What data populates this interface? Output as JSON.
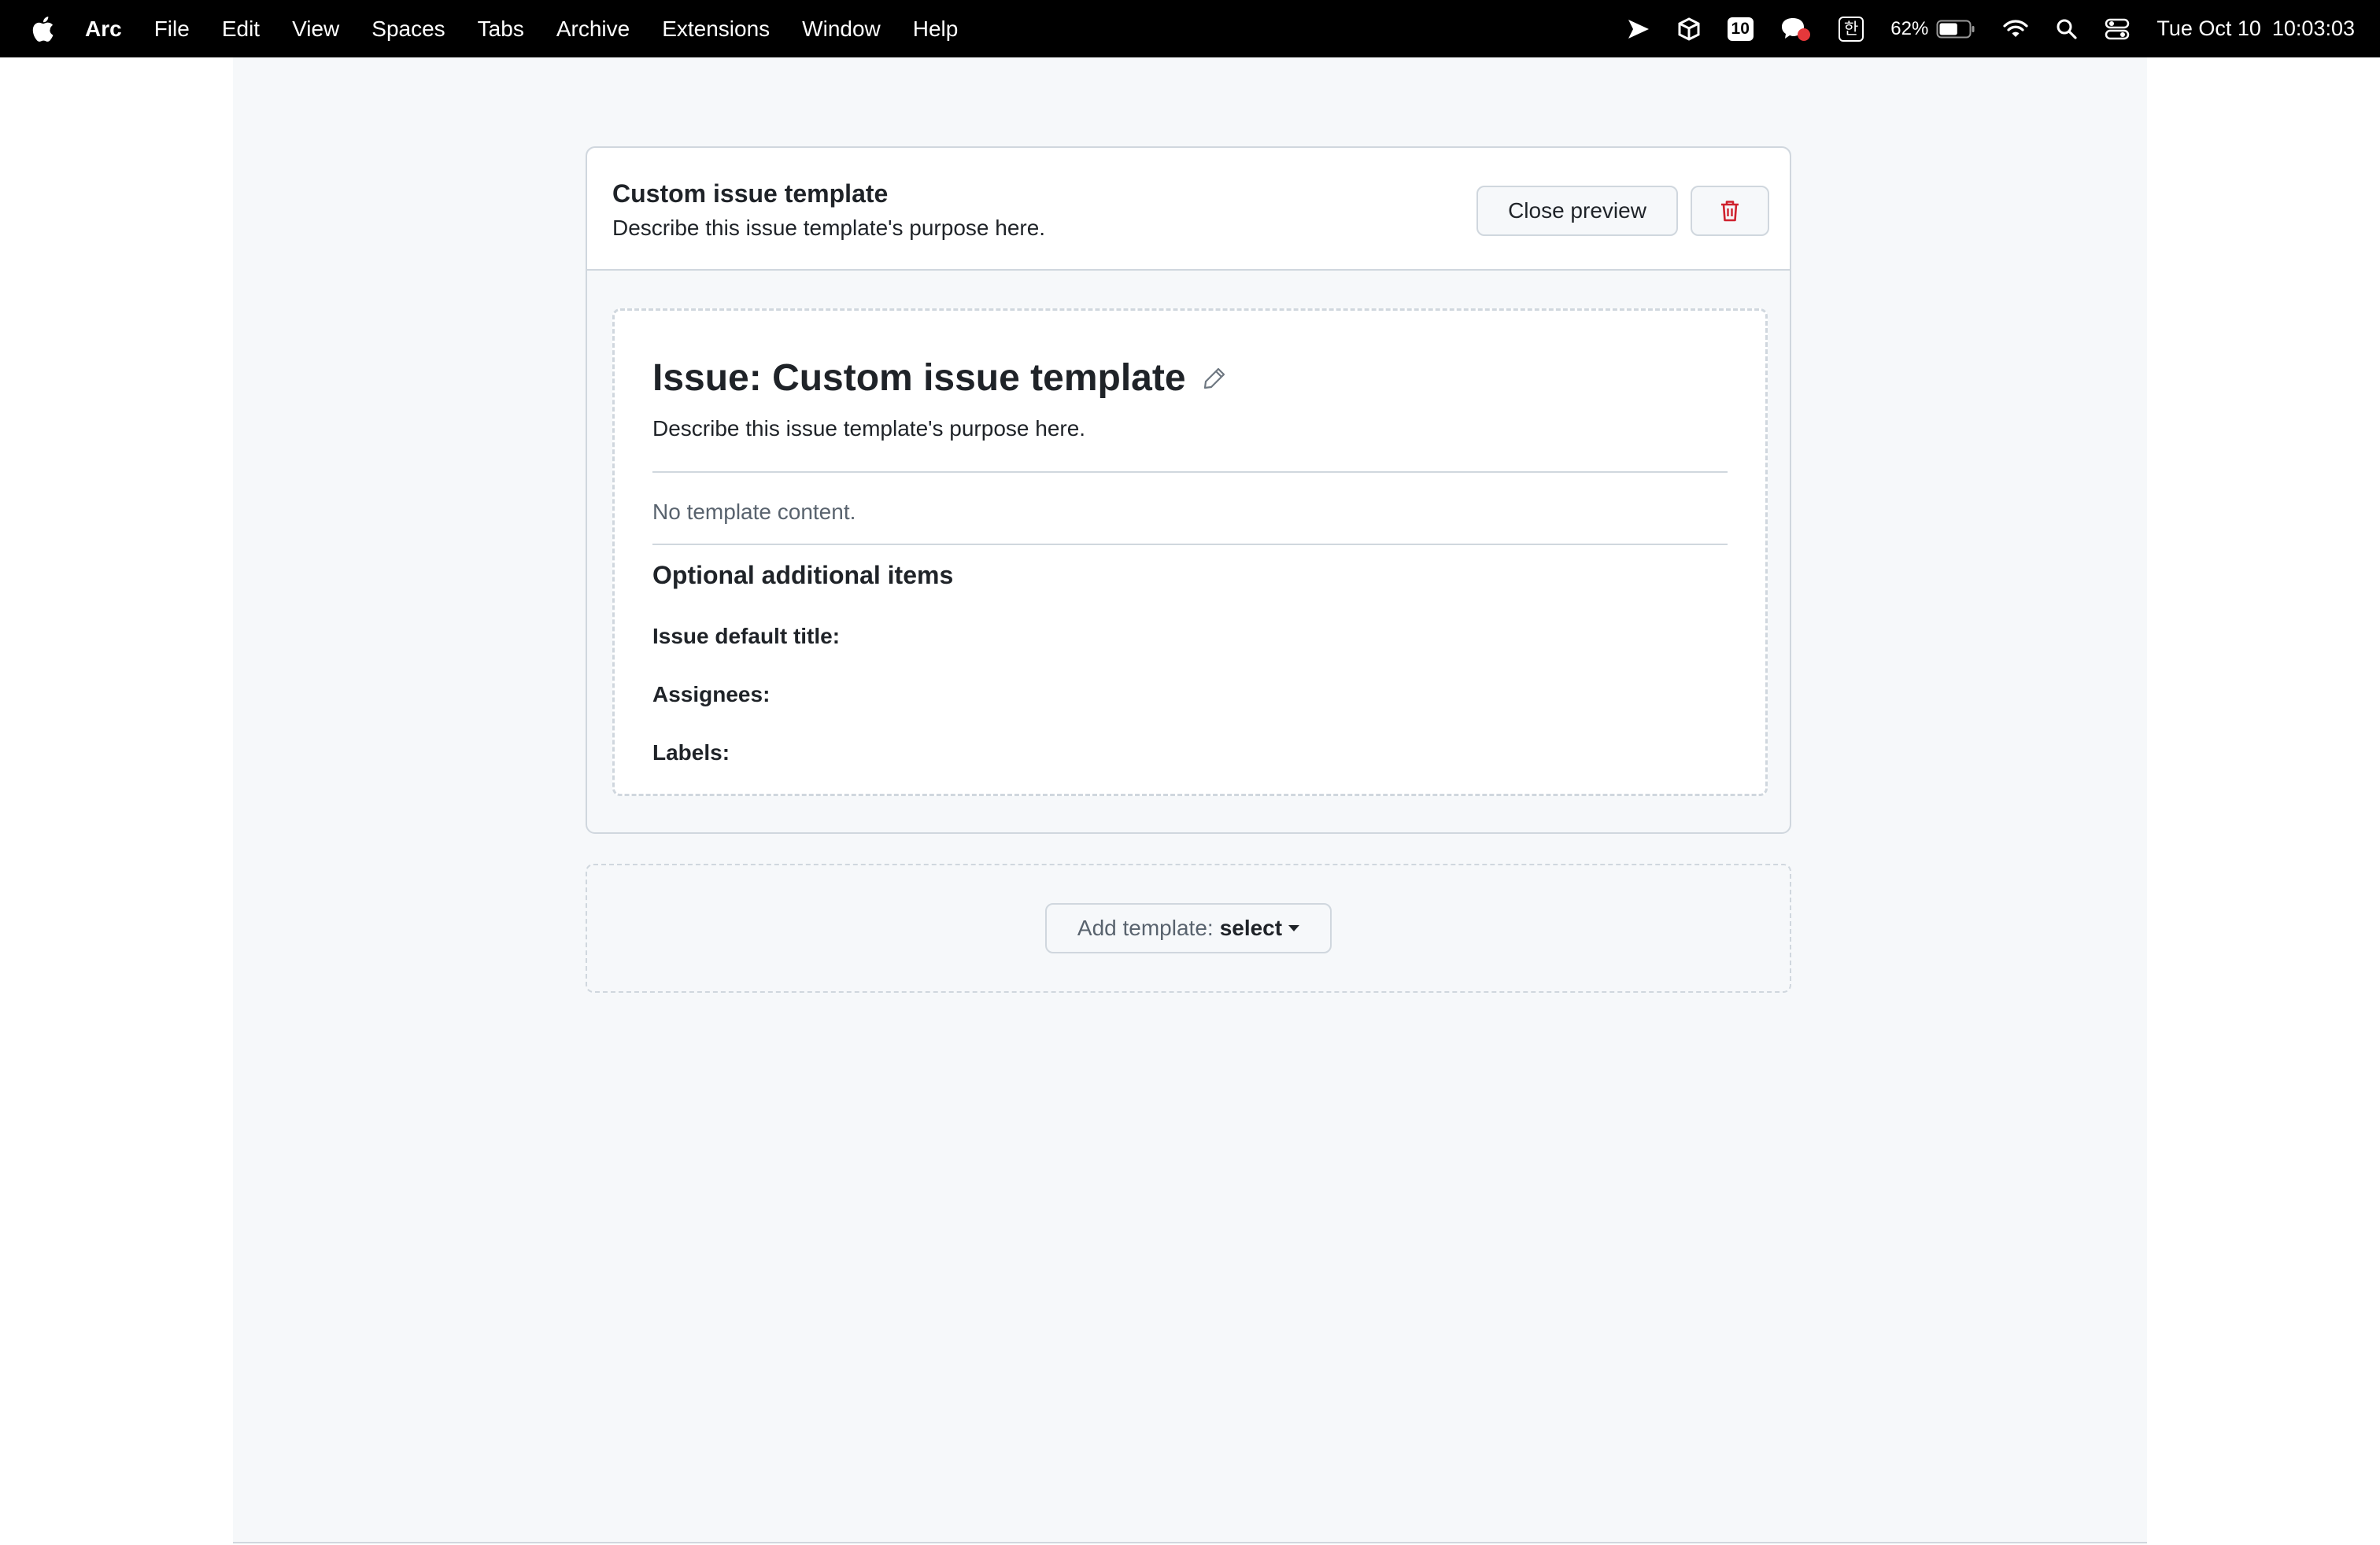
{
  "menubar": {
    "app_name": "Arc",
    "items": [
      "File",
      "Edit",
      "View",
      "Spaces",
      "Tabs",
      "Archive",
      "Extensions",
      "Window",
      "Help"
    ],
    "status": {
      "badge_10": "10",
      "korean_input": "한",
      "battery_percent": "62%",
      "battery_level": 0.62,
      "date": "Tue Oct 10",
      "time": "10:03:03"
    },
    "icons": [
      "apple-icon",
      "send-icon",
      "box-icon",
      "notification-badge-icon",
      "chat-icon",
      "input-method-icon",
      "battery-icon",
      "wifi-icon",
      "spotlight-search-icon",
      "control-center-icon"
    ]
  },
  "template": {
    "name": "Custom issue template",
    "description": "Describe this issue template's purpose here.",
    "close_preview_label": "Close preview",
    "delete_icon": "trash-icon",
    "preview": {
      "title": "Issue: Custom issue template",
      "edit_icon": "pencil-icon",
      "description": "Describe this issue template's purpose here.",
      "empty_message": "No template content.",
      "optional_heading": "Optional additional items",
      "fields": {
        "default_title": "Issue default title:",
        "assignees": "Assignees:",
        "labels": "Labels:"
      }
    }
  },
  "add_template": {
    "prefix": "Add template:",
    "value": "select"
  },
  "colors": {
    "danger": "#cf222e",
    "border": "#d0d7de",
    "page_bg": "#f6f8fa",
    "muted_text": "#59636e"
  }
}
